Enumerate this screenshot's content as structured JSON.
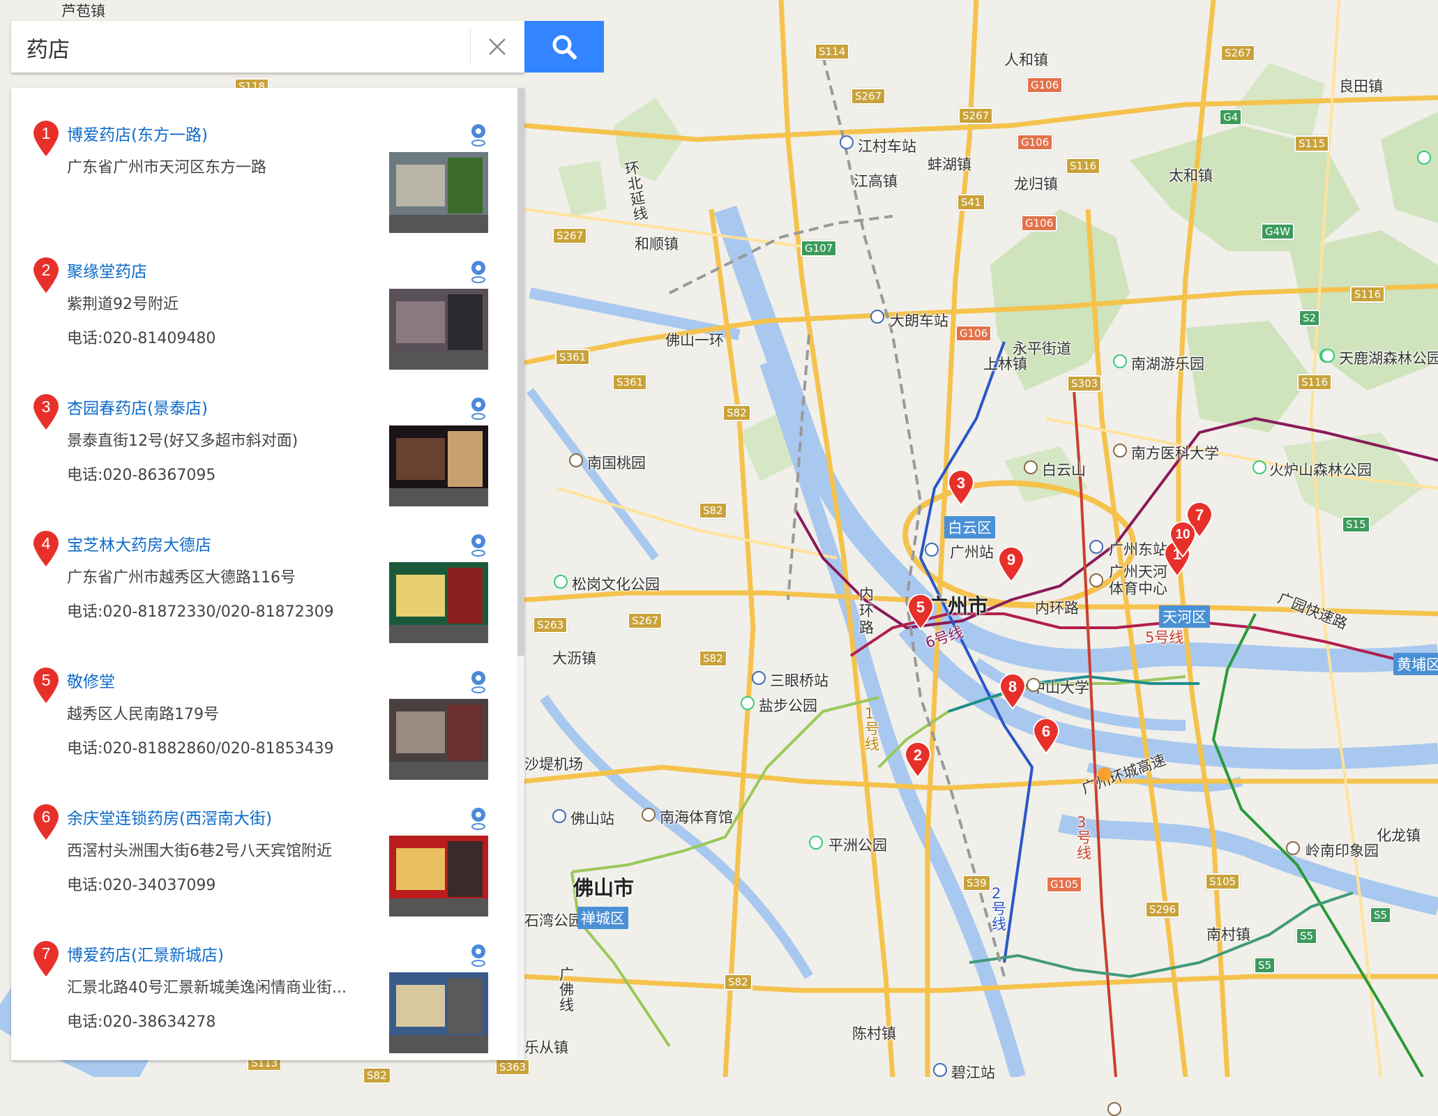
{
  "search": {
    "query": "药店",
    "clear_glyph": "×"
  },
  "results": [
    {
      "num": "1",
      "name": "博爱药店(东方一路)",
      "address": "广东省广州市天河区东方一路",
      "phone": ""
    },
    {
      "num": "2",
      "name": "聚缘堂药店",
      "address": "紫荆道92号附近",
      "phone": "电话:020-81409480"
    },
    {
      "num": "3",
      "name": "杏园春药店(景泰店)",
      "address": "景泰直街12号(好又多超市斜对面)",
      "phone": "电话:020-86367095"
    },
    {
      "num": "4",
      "name": "宝芝林大药房大德店",
      "address": "广东省广州市越秀区大德路116号",
      "phone": "电话:020-81872330/020-81872309"
    },
    {
      "num": "5",
      "name": "敬修堂",
      "address": "越秀区人民南路179号",
      "phone": "电话:020-81882860/020-81853439"
    },
    {
      "num": "6",
      "name": "余庆堂连锁药房(西滘南大街)",
      "address": "西滘村头洲围大街6巷2号八天宾馆附近",
      "phone": "电话:020-34037099"
    },
    {
      "num": "7",
      "name": "博爱药店(汇景新城店)",
      "address": "汇景北路40号汇景新城美逸闲情商业街...",
      "phone": "电话:020-38634278"
    }
  ],
  "map": {
    "towns": [
      "芦苞镇",
      "人和镇",
      "良田镇",
      "江村车站",
      "蚌湖镇",
      "太和镇",
      "江高镇",
      "龙归镇",
      "和顺镇",
      "大朗车站",
      "佛山一环",
      "永平街道",
      "上林镇",
      "南湖游乐园",
      "天鹿湖森林公园",
      "南国桃园",
      "白云山",
      "南方医科大学",
      "火炉山森林公园",
      "广州站",
      "广州东站",
      "广州天河体育中心",
      "广州市",
      "内环路",
      "内环路",
      "松岗文化公园",
      "大沥镇",
      "三眼桥站",
      "盐步公园",
      "中山大学",
      "广州环城高速",
      "广园快速路",
      "沙堤机场",
      "佛山站",
      "南海体育馆",
      "平洲公园",
      "佛山市",
      "石湾公园",
      "化龙镇",
      "岭南印象园",
      "南村镇",
      "陈村镇",
      "碧江站",
      "乐从镇",
      "环北延线",
      "广佛线"
    ],
    "districts": [
      "白云区",
      "天河区",
      "黄埔区",
      "禅城区"
    ],
    "roads": [
      "S114",
      "S267",
      "S267",
      "S267",
      "G106",
      "G106",
      "G106",
      "G106",
      "S116",
      "S41",
      "G107",
      "G4",
      "S115",
      "G4W",
      "S116",
      "S2",
      "S267",
      "S361",
      "S361",
      "S303",
      "S116",
      "S82",
      "S82",
      "S15",
      "S263",
      "S267",
      "S82",
      "S39",
      "G105",
      "S296",
      "S105",
      "S5",
      "S5",
      "S5",
      "S82",
      "S363",
      "S82",
      "S113",
      "S118"
    ],
    "metro_labels": [
      "6号线",
      "5号线",
      "1号线",
      "2号线",
      "3号线"
    ],
    "pins": [
      "1",
      "2",
      "3",
      "5",
      "6",
      "7",
      "8",
      "9",
      "10"
    ]
  }
}
